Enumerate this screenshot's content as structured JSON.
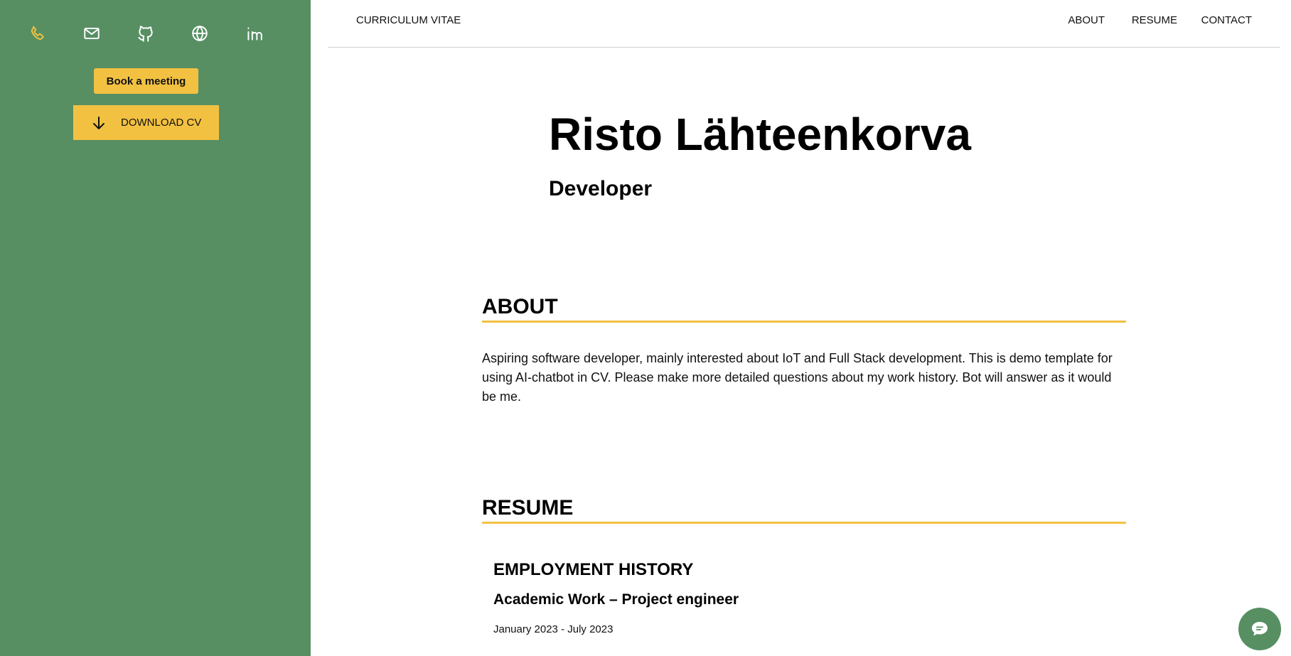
{
  "colors": {
    "sidebar": "#578f63",
    "accent": "#f3c141",
    "phone_icon": "#f3c141",
    "icon": "#ffffff"
  },
  "sidebar": {
    "icons": [
      "phone-icon",
      "mail-icon",
      "github-icon",
      "globe-icon",
      "linkedin-icon"
    ],
    "book_label": "Book a meeting",
    "download_label": "DOWNLOAD CV"
  },
  "nav": {
    "brand": "CURRICULUM VITAE",
    "links": [
      "ABOUT",
      "RESUME",
      "CONTACT"
    ]
  },
  "hero": {
    "name": "Risto Lähteenkorva",
    "role": "Developer"
  },
  "about": {
    "heading": "ABOUT",
    "text": "Aspiring software developer, mainly interested about IoT and Full Stack development. This is demo template for using AI-chatbot in CV. Please make more detailed questions about my work history. Bot will answer as it would be me."
  },
  "resume": {
    "heading": "RESUME",
    "employment_heading": "EMPLOYMENT HISTORY",
    "job": {
      "title": "Academic Work – Project engineer",
      "dates": "January 2023 - July 2023"
    }
  },
  "chat": {
    "icon": "chat-bubble-icon"
  }
}
